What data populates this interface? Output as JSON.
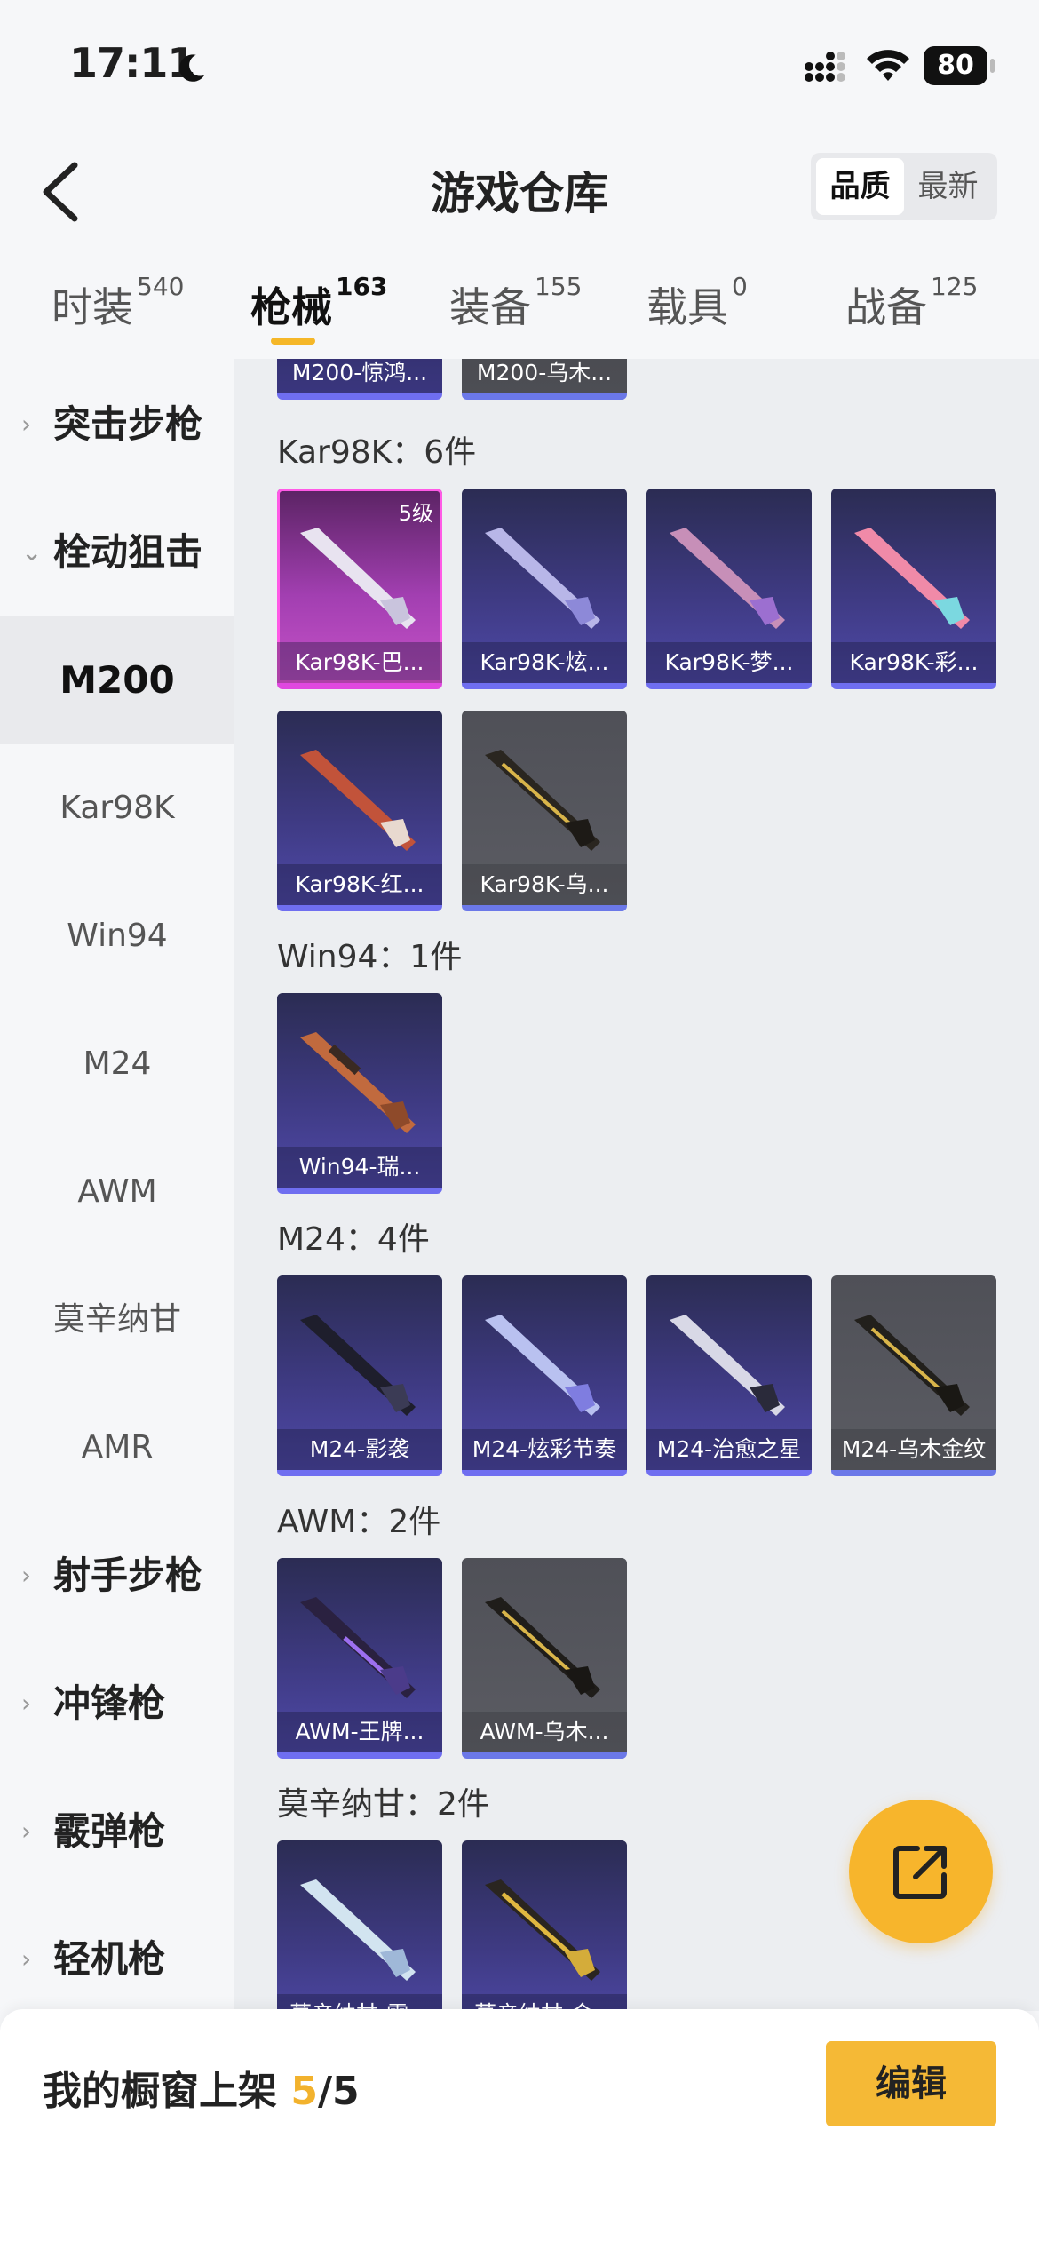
{
  "status_bar": {
    "time": "17:11",
    "battery": "80"
  },
  "header": {
    "title": "游戏仓库",
    "sort_options": [
      "品质",
      "最新"
    ],
    "active_sort": "品质"
  },
  "tabs": [
    {
      "label": "时装",
      "count": "540"
    },
    {
      "label": "枪械",
      "count": "163"
    },
    {
      "label": "装备",
      "count": "155"
    },
    {
      "label": "载具",
      "count": "0"
    },
    {
      "label": "战备",
      "count": "125"
    }
  ],
  "active_tab": "枪械",
  "sidebar": {
    "items": [
      {
        "label": "突击步枪",
        "type": "category"
      },
      {
        "label": "栓动狙击",
        "type": "category",
        "expanded": true
      },
      {
        "label": "M200",
        "type": "sub",
        "selected": true
      },
      {
        "label": "Kar98K",
        "type": "sub"
      },
      {
        "label": "Win94",
        "type": "sub"
      },
      {
        "label": "M24",
        "type": "sub"
      },
      {
        "label": "AWM",
        "type": "sub"
      },
      {
        "label": "莫辛纳甘",
        "type": "sub"
      },
      {
        "label": "AMR",
        "type": "sub"
      },
      {
        "label": "射手步枪",
        "type": "category"
      },
      {
        "label": "冲锋枪",
        "type": "category"
      },
      {
        "label": "霰弹枪",
        "type": "category"
      },
      {
        "label": "轻机枪",
        "type": "category"
      }
    ]
  },
  "sections": [
    {
      "title": "",
      "items": [
        {
          "name": "M200-惊鸿...",
          "style": "purple"
        },
        {
          "name": "M200-乌木...",
          "style": "gold"
        }
      ]
    },
    {
      "title": "Kar98K：6件",
      "items": [
        {
          "name": "Kar98K-巴...",
          "style": "pink",
          "level": "5级"
        },
        {
          "name": "Kar98K-炫...",
          "style": "purple"
        },
        {
          "name": "Kar98K-梦...",
          "style": "purple"
        },
        {
          "name": "Kar98K-彩...",
          "style": "purple"
        },
        {
          "name": "Kar98K-红...",
          "style": "purple"
        },
        {
          "name": "Kar98K-乌...",
          "style": "gold"
        }
      ]
    },
    {
      "title": "Win94：1件",
      "items": [
        {
          "name": "Win94-瑞...",
          "style": "purple"
        }
      ]
    },
    {
      "title": "M24：4件",
      "items": [
        {
          "name": "M24-影袭",
          "style": "purple"
        },
        {
          "name": "M24-炫彩节奏",
          "style": "purple"
        },
        {
          "name": "M24-治愈之星",
          "style": "purple"
        },
        {
          "name": "M24-乌木金纹",
          "style": "gold"
        }
      ]
    },
    {
      "title": "AWM：2件",
      "items": [
        {
          "name": "AWM-王牌...",
          "style": "purple"
        },
        {
          "name": "AWM-乌木...",
          "style": "gold"
        }
      ]
    },
    {
      "title": "莫辛纳甘：2件",
      "items": [
        {
          "name": "莫辛纳甘-霜...",
          "style": "purple"
        },
        {
          "name": "莫辛纳甘-金...",
          "style": "purple"
        }
      ]
    }
  ],
  "bottom_bar": {
    "shelf_label": "我的橱窗上架 ",
    "shelf_current": "5",
    "shelf_total": "/5",
    "edit_label": "编辑"
  },
  "colors": {
    "accent": "#f5b936",
    "purple_card": "#3e3a82",
    "pink_card": "#a23fb1",
    "gold_card": "#5b5c63"
  }
}
